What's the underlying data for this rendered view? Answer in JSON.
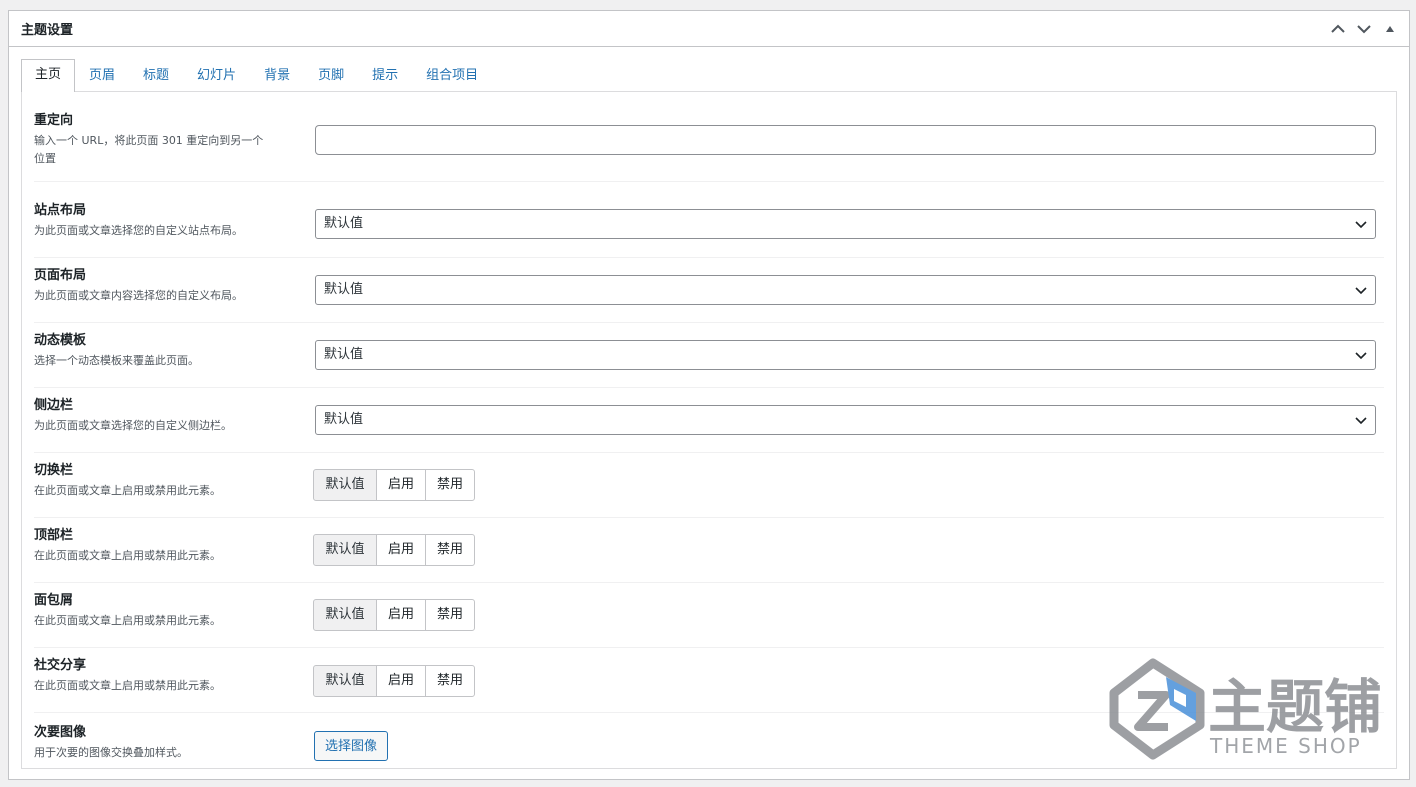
{
  "box": {
    "title": "主题设置"
  },
  "tabs": [
    "主页",
    "页眉",
    "标题",
    "幻灯片",
    "背景",
    "页脚",
    "提示",
    "组合项目"
  ],
  "fields": {
    "redirect": {
      "title": "重定向",
      "desc": "输入一个 URL，将此页面 301 重定向到另一个位置",
      "value": ""
    },
    "site_layout": {
      "title": "站点布局",
      "desc": "为此页面或文章选择您的自定义站点布局。",
      "selected": "默认值"
    },
    "page_layout": {
      "title": "页面布局",
      "desc": "为此页面或文章内容选择您的自定义布局。",
      "selected": "默认值"
    },
    "dynamic_template": {
      "title": "动态模板",
      "desc": "选择一个动态模板来覆盖此页面。",
      "selected": "默认值"
    },
    "sidebar": {
      "title": "侧边栏",
      "desc": "为此页面或文章选择您的自定义侧边栏。",
      "selected": "默认值"
    },
    "toggle_bar": {
      "title": "切换栏",
      "desc": "在此页面或文章上启用或禁用此元素。"
    },
    "top_bar": {
      "title": "顶部栏",
      "desc": "在此页面或文章上启用或禁用此元素。"
    },
    "breadcrumbs": {
      "title": "面包屑",
      "desc": "在此页面或文章上启用或禁用此元素。"
    },
    "social_share": {
      "title": "社交分享",
      "desc": "在此页面或文章上启用或禁用此元素。"
    },
    "secondary_image": {
      "title": "次要图像",
      "desc": "用于次要的图像交换叠加样式。",
      "button": "选择图像"
    }
  },
  "toggle_options": {
    "default": "默认值",
    "enable": "启用",
    "disable": "禁用"
  },
  "watermark": {
    "brand": "主题铺",
    "tagline": "THEME SHOP"
  },
  "colors": {
    "link": "#2271b1",
    "border": "#c3c4c7",
    "watermark_gray": "#8c8f94",
    "watermark_blue": "#4a90d9"
  }
}
